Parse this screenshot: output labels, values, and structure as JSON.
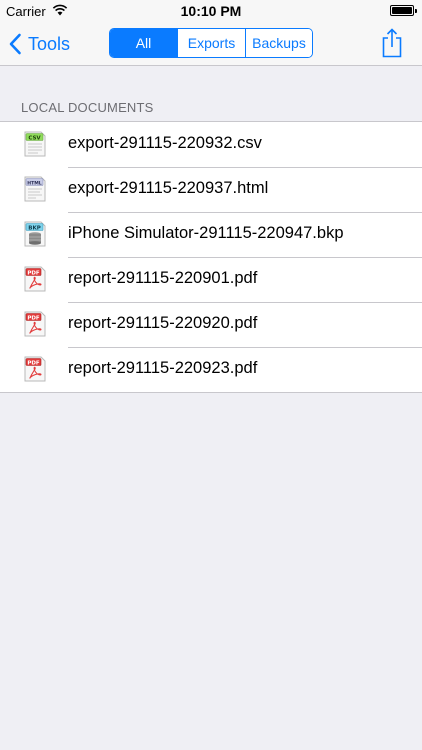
{
  "status": {
    "carrier": "Carrier",
    "time": "10:10 PM",
    "battery_level": 1.0
  },
  "nav": {
    "back_label": "Tools",
    "segments": [
      {
        "label": "All",
        "selected": true
      },
      {
        "label": "Exports",
        "selected": false
      },
      {
        "label": "Backups",
        "selected": false
      }
    ],
    "share_icon": "share-icon"
  },
  "section": {
    "header": "LOCAL DOCUMENTS"
  },
  "files": [
    {
      "name": "export-291115-220932.csv",
      "type_label": "CSV",
      "icon": "csv-file-icon"
    },
    {
      "name": "export-291115-220937.html",
      "type_label": "HTML",
      "icon": "html-file-icon"
    },
    {
      "name": "iPhone Simulator-291115-220947.bkp",
      "type_label": "BKP",
      "icon": "bkp-file-icon"
    },
    {
      "name": "report-291115-220901.pdf",
      "type_label": "PDF",
      "icon": "pdf-file-icon"
    },
    {
      "name": "report-291115-220920.pdf",
      "type_label": "PDF",
      "icon": "pdf-file-icon"
    },
    {
      "name": "report-291115-220923.pdf",
      "type_label": "PDF",
      "icon": "pdf-file-icon"
    }
  ],
  "colors": {
    "accent": "#0a7bff",
    "background": "#efeff4",
    "separator": "#c8c7cc",
    "section_header": "#6d6d72",
    "csv_badge": "#8fdc5a",
    "html_badge": "#c9cde8",
    "bkp_badge": "#7fd3ec",
    "pdf_badge": "#e23b3b"
  }
}
